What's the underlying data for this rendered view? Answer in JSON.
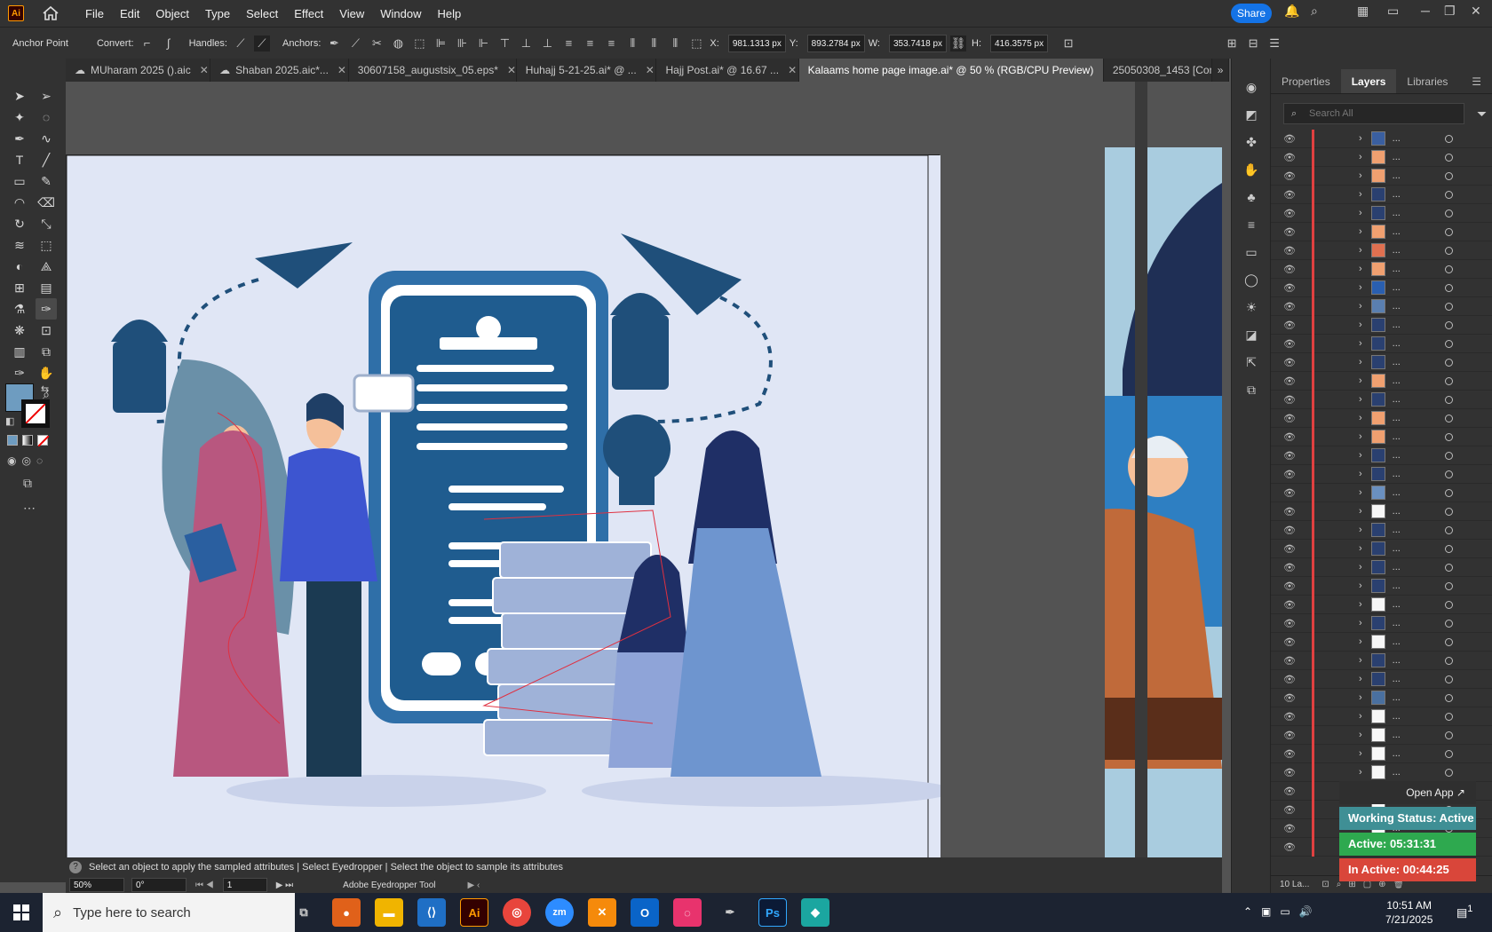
{
  "app": {
    "logo": "Ai"
  },
  "menu": [
    "File",
    "Edit",
    "Object",
    "Type",
    "Select",
    "Effect",
    "View",
    "Window",
    "Help"
  ],
  "share_label": "Share",
  "control": {
    "tool_label": "Anchor Point",
    "convert_label": "Convert:",
    "handles_label": "Handles:",
    "anchors_label": "Anchors:",
    "x_label": "X:",
    "x_value": "981.1313 px",
    "y_label": "Y:",
    "y_value": "893.2784 px",
    "w_label": "W:",
    "w_value": "353.7418 px",
    "h_label": "H:",
    "h_value": "416.3575 px"
  },
  "tabs": [
    {
      "label": "MUharam 2025 ().aic"
    },
    {
      "label": "Shaban 2025.aic*..."
    },
    {
      "label": "30607158_augustsix_05.eps*"
    },
    {
      "label": "Huhajj 5-21-25.ai* @ ..."
    },
    {
      "label": "Hajj Post.ai* @ 16.67 ..."
    },
    {
      "label": "Kalaams home page image.ai* @ 50 % (RGB/CPU Preview)"
    },
    {
      "label": "25050308_1453 [Conv"
    }
  ],
  "status_message": "Select an object to apply the sampled attributes  |  Select Eyedropper  |  Select the object to sample its attributes",
  "statusbar": {
    "zoom": "50%",
    "rotate": "0°",
    "artboard": "1",
    "tool": "Adobe Eyedropper Tool"
  },
  "panels": {
    "tab_properties": "Properties",
    "tab_layers": "Layers",
    "tab_libraries": "Libraries",
    "search_placeholder": "Search All",
    "layers_count": "10 La..."
  },
  "layer_dots": "...",
  "layer_thumbs": [
    "#3a5fa0",
    "#f0a070",
    "#f0a070",
    "#2a4070",
    "#2a4070",
    "#f0a070",
    "#e07050",
    "#f0a070",
    "#2a5fb0",
    "#5a7fb0",
    "#2a4070",
    "#2a4070",
    "#2a4070",
    "#f0a070",
    "#2a4070",
    "#f0a070",
    "#f0a070",
    "#2a4070",
    "#2a4070",
    "#6a90c0",
    "#f7f7f7",
    "#2a4070",
    "#2a4070",
    "#2a4070",
    "#2a4070",
    "#f7f7f7",
    "#2a4070",
    "#f7f7f7",
    "#2a4070",
    "#2a4070",
    "#4a70a0",
    "#f7f7f7",
    "#f7f7f7",
    "#f7f7f7",
    "#f7f7f7",
    "#555555",
    "#f7f7f7",
    "#f7f7f7",
    "#f7f7f7"
  ],
  "widget": {
    "open_app": "Open App ↗",
    "status": "Working Status: Active",
    "active": "Active: 05:31:31",
    "inactive": "In Active: 00:44:25"
  },
  "taskbar": {
    "search_placeholder": "Type here to search",
    "time": "10:51 AM",
    "date": "7/21/2025",
    "notif_count": "1"
  },
  "colors": {
    "accent": "#1473e6",
    "artboard_bg": "#e0e6f5",
    "navy": "#1f4f7a",
    "pink": "#b8577f",
    "active_green": "#2ea94f",
    "inactive_red": "#d9463a",
    "status_teal": "#3f8f95"
  }
}
